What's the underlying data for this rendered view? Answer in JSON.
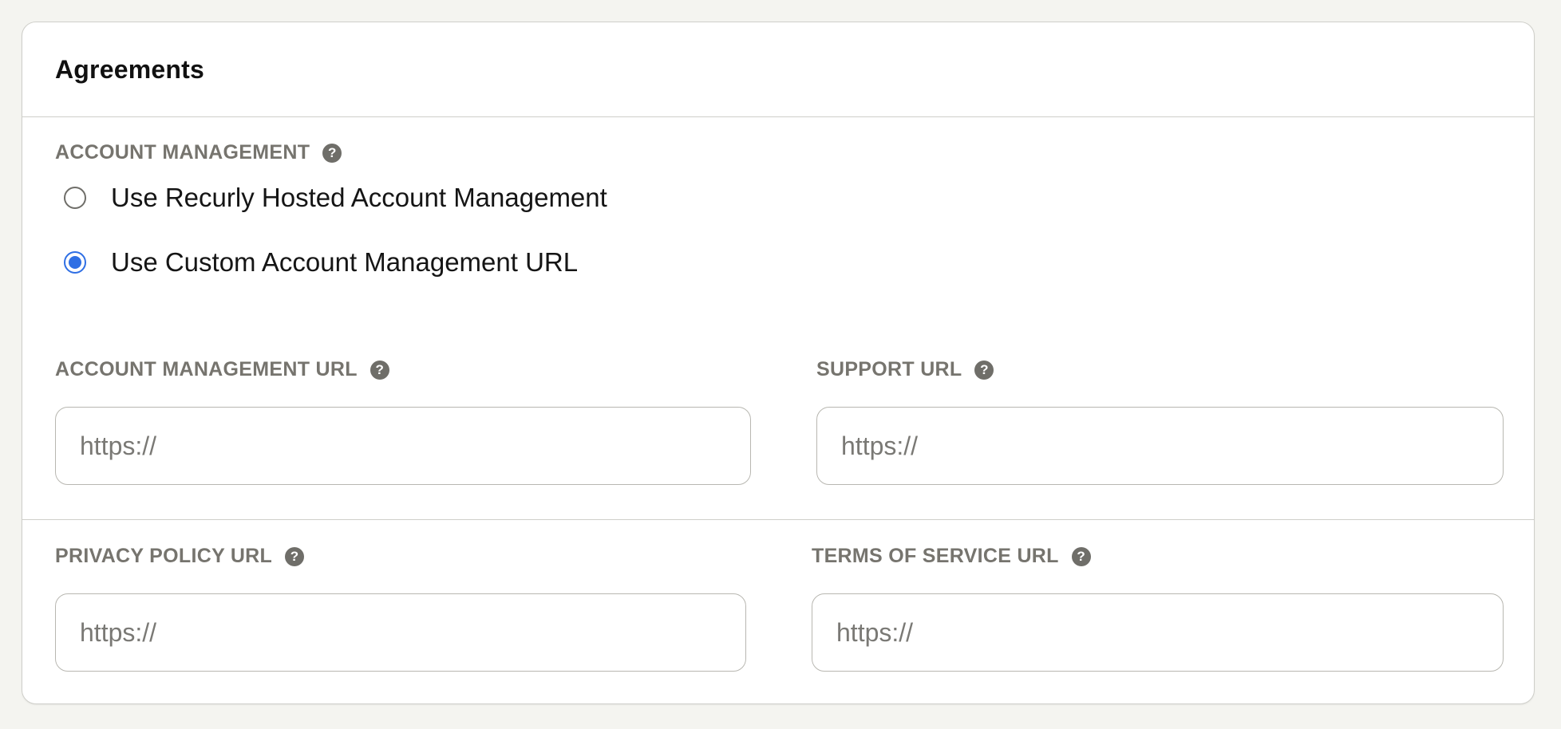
{
  "card": {
    "title": "Agreements"
  },
  "account_management": {
    "label": "ACCOUNT MANAGEMENT",
    "options": [
      {
        "label": "Use Recurly Hosted Account Management",
        "checked": false
      },
      {
        "label": "Use Custom Account Management URL",
        "checked": true
      }
    ]
  },
  "fields": {
    "account_management_url": {
      "label": "ACCOUNT MANAGEMENT URL",
      "placeholder": "https://",
      "value": ""
    },
    "support_url": {
      "label": "SUPPORT URL",
      "placeholder": "https://",
      "value": ""
    },
    "privacy_policy_url": {
      "label": "PRIVACY POLICY URL",
      "placeholder": "https://",
      "value": ""
    },
    "terms_of_service_url": {
      "label": "TERMS OF SERVICE URL",
      "placeholder": "https://",
      "value": ""
    }
  },
  "help_icon_glyph": "?",
  "colors": {
    "accent": "#2f6fe4",
    "label": "#76746e",
    "background": "#f4f4f0"
  }
}
